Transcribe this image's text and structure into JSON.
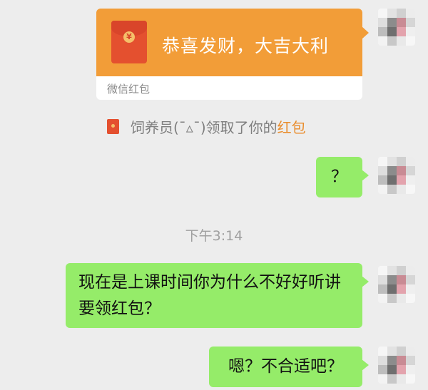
{
  "conversation": {
    "red_packet": {
      "coin_symbol": "¥",
      "title": "恭喜发财，大吉大利",
      "footer": "微信红包"
    },
    "notice": {
      "prefix": "饲养员(ˉ▵ˉ)领取了你的",
      "link": "红包"
    },
    "messages": [
      {
        "text": "？"
      }
    ],
    "timestamp": "下午3:14",
    "later_messages": [
      {
        "text": "现在是上课时间你为什么不好好听讲要领红包？"
      },
      {
        "text": "嗯？不合适吧？"
      }
    ]
  },
  "colors": {
    "background": "#ededed",
    "bubble_green": "#95ec69",
    "packet_orange": "#f29d38",
    "packet_red": "#e4502f",
    "link_orange": "#e98c2b"
  }
}
